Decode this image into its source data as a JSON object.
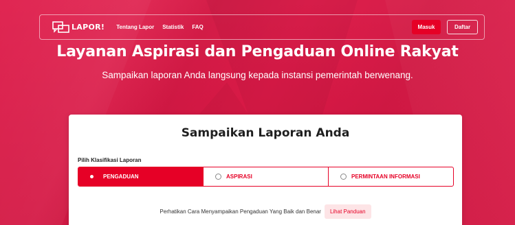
{
  "navbar": {
    "logo_text": "LAPOR!",
    "links": [
      "Tentang Lapor",
      "Statistik",
      "FAQ"
    ],
    "login_label": "Masuk",
    "register_label": "Daftar"
  },
  "hero": {
    "title": "Layanan Aspirasi dan Pengaduan Online Rakyat",
    "subtitle": "Sampaikan laporan Anda langsung kepada instansi pemerintah berwenang."
  },
  "form": {
    "title": "Sampaikan Laporan Anda",
    "classification_label": "Pilih Klasifikasi Laporan",
    "options": [
      {
        "label": "PENGADUAN",
        "selected": true
      },
      {
        "label": "ASPIRASI",
        "selected": false
      },
      {
        "label": "PERMINTAAN INFORMASI",
        "selected": false
      }
    ],
    "guide_text": "Perhatikan Cara Menyampaikan Pengaduan Yang Baik dan Benar",
    "guide_button": "Lihat Panduan"
  },
  "colors": {
    "brand_red": "#e60026",
    "hero_bg": "#d3123f"
  }
}
